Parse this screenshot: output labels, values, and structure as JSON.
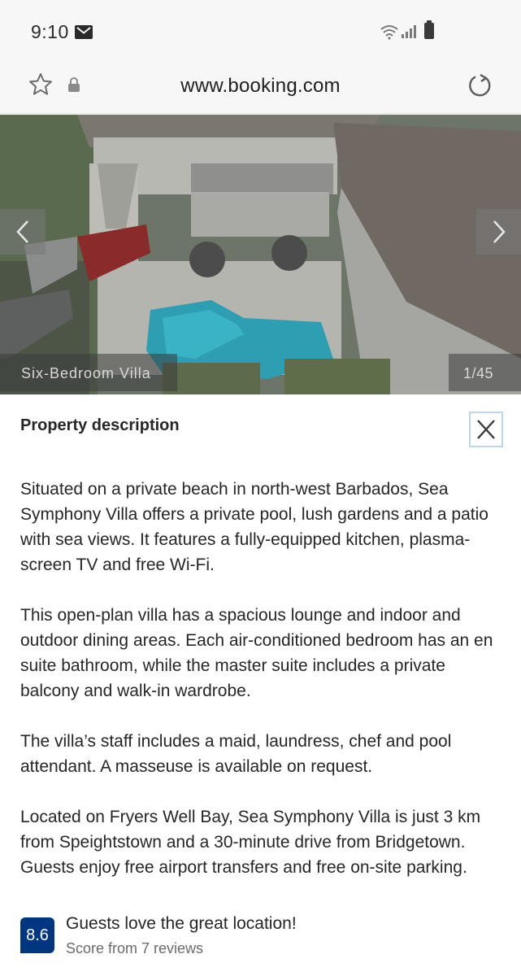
{
  "status_bar": {
    "time": "9:10"
  },
  "address_bar": {
    "url": "www.booking.com"
  },
  "photo": {
    "caption": "Six-Bedroom Villa",
    "counter": "1/45"
  },
  "description": {
    "title": "Property description",
    "paragraphs": [
      "Situated on a private beach in north-west Barbados, Sea Symphony Villa offers a private pool, lush gardens and a patio with sea views. It features a fully-equipped kitchen, plasma-screen TV and free Wi-Fi.",
      "This open-plan villa has a spacious lounge and indoor and outdoor dining areas. Each air-conditioned bedroom has an en suite bathroom, while the master suite includes a private balcony and walk-in wardrobe.",
      "The villa’s staff includes a maid, laundress, chef and pool attendant. A masseuse is available on request.",
      "Located on Fryers Well Bay, Sea Symphony Villa is just 3 km from Speightstown and a 30-minute drive from Bridgetown. Guests enjoy free airport transfers and free on-site parking."
    ]
  },
  "review": {
    "score": "8.6",
    "headline": "Guests love the great location!",
    "count_text": "Score from 7 reviews"
  },
  "colors": {
    "brand_blue": "#003580",
    "close_border": "#bcd6ef"
  },
  "icons": [
    "mail-icon",
    "wifi-icon",
    "signal-icon",
    "battery-icon",
    "star-icon",
    "lock-icon",
    "reload-icon",
    "chevron-left-icon",
    "chevron-right-icon",
    "close-icon"
  ]
}
